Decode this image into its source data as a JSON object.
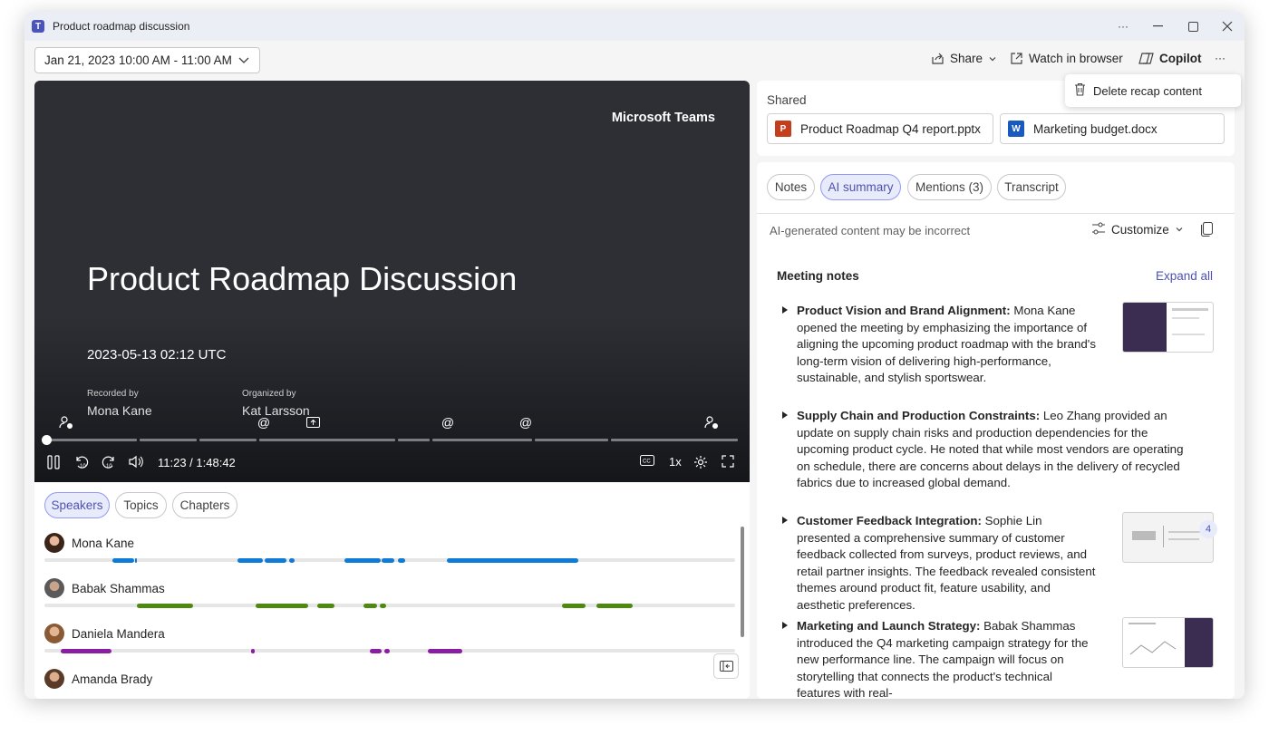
{
  "window": {
    "title": "Product roadmap discussion",
    "more_label": "···"
  },
  "toolbar": {
    "date_range": "Jan 21, 2023 10:00 AM - 11:00 AM",
    "share_label": "Share",
    "watch_label": "Watch in browser",
    "copilot_label": "Copilot",
    "more_label": "···"
  },
  "context_menu": {
    "delete_label": "Delete recap content"
  },
  "video": {
    "brand": "Microsoft Teams",
    "title": "Product Roadmap Discussion",
    "date": "2023-05-13 02:12 UTC",
    "recorded_by_label": "Recorded by",
    "recorded_by": "Mona Kane",
    "organized_by_label": "Organized by",
    "organized_by": "Kat Larsson",
    "timecode": "11:23 / 1:48:42",
    "speed": "1x",
    "progress_fraction": 0.0
  },
  "speakers_panel": {
    "tabs": [
      "Speakers",
      "Topics",
      "Chapters"
    ],
    "active_tab": "Speakers",
    "speakers": [
      {
        "name": "Mona Kane",
        "color": "#0f7bd6"
      },
      {
        "name": "Babak Shammas",
        "color": "#4f8a10"
      },
      {
        "name": "Daniela Mandera",
        "color": "#8a1ea3"
      },
      {
        "name": "Amanda Brady",
        "color": "#0f7bd6"
      }
    ]
  },
  "shared": {
    "label": "Shared",
    "files": [
      {
        "name": "Product Roadmap Q4 report.pptx",
        "icon": "powerpoint-icon",
        "color": "#c43e1c",
        "glyph": "P"
      },
      {
        "name": "Marketing budget.docx",
        "icon": "word-icon",
        "color": "#185abd",
        "glyph": "W"
      }
    ]
  },
  "notes_panel": {
    "tabs": [
      "Notes",
      "AI summary",
      "Mentions (3)",
      "Transcript"
    ],
    "active_tab": "AI summary",
    "disclaimer": "AI-generated content may be incorrect",
    "customize_label": "Customize",
    "section_title": "Meeting notes",
    "expand_all": "Expand all",
    "thumb_badge": "4",
    "items": [
      {
        "heading": "Product Vision and Brand Alignment:",
        "text": " Mona Kane opened the meeting by emphasizing the importance of aligning the upcoming product roadmap with the brand's long-term vision of delivering high-performance, sustainable, and stylish sportswear."
      },
      {
        "heading": "Supply Chain and Production Constraints:",
        "text": " Leo Zhang provided an update on supply chain risks and production dependencies for the upcoming product cycle. He noted that while most vendors are operating on schedule, there are concerns about delays in the delivery of recycled fabrics due to increased global demand."
      },
      {
        "heading": "Customer Feedback Integration:",
        "text": " Sophie Lin presented a comprehensive summary of customer feedback collected from surveys, product reviews, and retail partner insights. The feedback revealed consistent themes around product fit, feature usability, and aesthetic preferences."
      },
      {
        "heading": "Marketing and Launch Strategy:",
        "text": " Babak Shammas introduced the Q4 marketing campaign strategy for the new performance line. The campaign will focus on storytelling that connects the product's technical features with real-"
      }
    ]
  }
}
